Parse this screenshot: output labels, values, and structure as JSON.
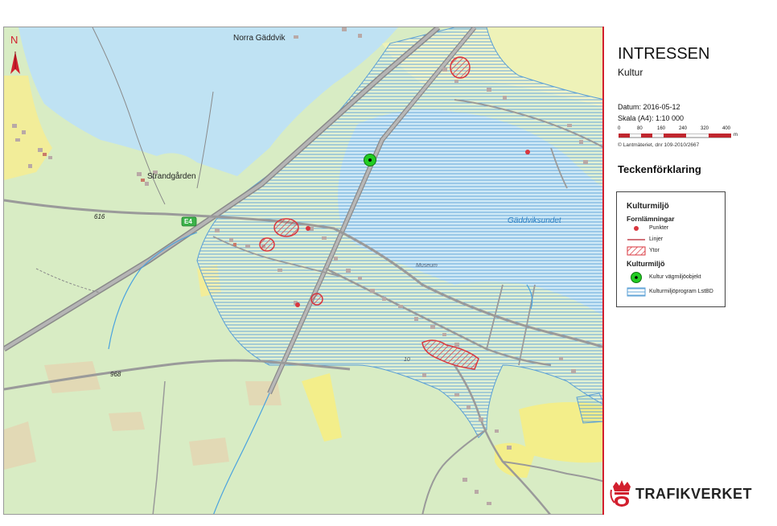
{
  "map": {
    "places": {
      "norra_gaddvik": "Norra Gäddvik",
      "strandgarden": "Strandgården",
      "gaddviksundet": "Gäddviksundet",
      "museum": "Museum"
    },
    "road_labels": {
      "r616": "616",
      "r968": "968",
      "r10": "10",
      "e4": "E4"
    },
    "north_label": "N"
  },
  "panel": {
    "title": "INTRESSEN",
    "subtitle": "Kultur",
    "date_line": "Datum: 2016-05-12",
    "scale_line": "Skala (A4): 1:10 000",
    "scale_ticks": [
      "0",
      "80",
      "160",
      "240",
      "320",
      "400"
    ],
    "scale_unit": "m",
    "copyright": "© Lantmäteriet, dnr 109-2010/2667",
    "legend_heading": "Teckenförklaring",
    "legend": {
      "section": "Kulturmiljö",
      "subsection1": "Fornlämningar",
      "item_points": "Punkter",
      "item_lines": "Linjer",
      "item_areas": "Ytor",
      "subsection2": "Kulturmiljö",
      "item_object": "Kultur vägmiljöobjekt",
      "item_program": "Kulturmiljöprogram LstBD"
    },
    "brand": "TRAFIKVERKET"
  },
  "colors": {
    "water": "#bfe2f3",
    "land": "#d8ecc4",
    "brand_red": "#d21f2e",
    "hatch_blue": "#5a9fd6"
  }
}
